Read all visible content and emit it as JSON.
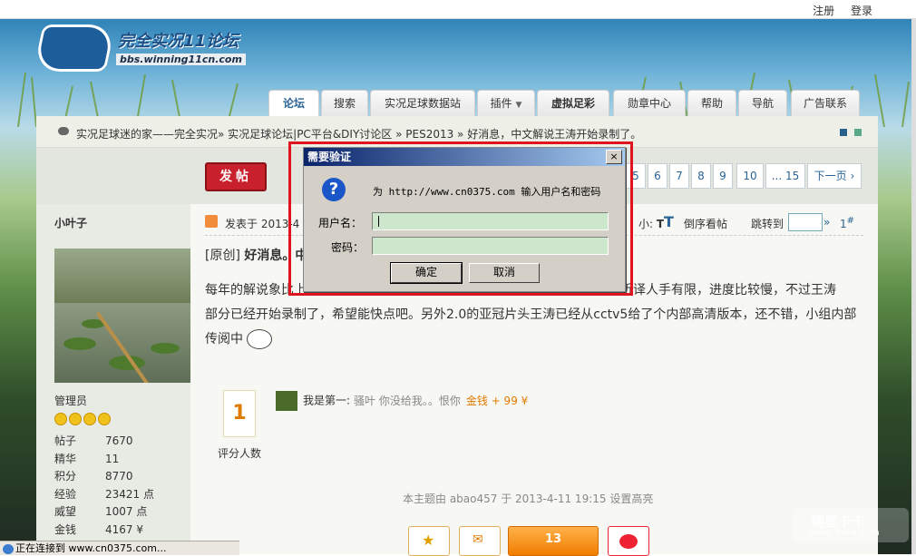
{
  "topbar": {
    "register": "注册",
    "login": "登录"
  },
  "logo": {
    "title": "完全实况11论坛",
    "url": "bbs.winning11cn.com"
  },
  "nav": {
    "tabs": [
      "论坛",
      "搜索",
      "实况足球数据站",
      "插件",
      "虚拟足彩",
      "勋章中心",
      "帮助",
      "导航",
      "广告联系"
    ]
  },
  "breadcrumb": "实况足球迷的家——完全实况» 实况足球论坛|PC平台&DIY讨论区 » PES2013 » 好消息，中文解说王涛开始录制了。",
  "toolbar": {
    "post_label": "发帖",
    "pages": [
      "5",
      "6",
      "7",
      "8",
      "9",
      "10",
      "... 15"
    ],
    "next_label": "下一页"
  },
  "author": {
    "name": "小叶子",
    "role": "管理员",
    "stats": [
      {
        "k": "帖子",
        "v": "7670"
      },
      {
        "k": "精华",
        "v": "11"
      },
      {
        "k": "积分",
        "v": "8770"
      },
      {
        "k": "经验",
        "v": "23421 点"
      },
      {
        "k": "威望",
        "v": "1007 点"
      },
      {
        "k": "金钱",
        "v": "4167 ¥"
      }
    ]
  },
  "post": {
    "posted_prefix": "发表于 2013-4",
    "font_small": "小:",
    "font_t": "T",
    "font_big": "T",
    "reverse": "倒序看帖",
    "jump": "跳转到",
    "jump_arrow": "»",
    "floor": "1",
    "floor_mark": "#",
    "title_prefix": "[原创]",
    "title": "好消息。中",
    "body_line1": "每年的解说象比上",
    "body_line1_end": "前听译人手有限，进度比较慢，不过王涛",
    "body_line2": "部分已经开始录制了，希望能快点吧。另外2.0的亚冠片头王涛已经从cctv5给了个内部高清版本，还不错，小组内部",
    "body_line3": "传阅中",
    "rate_count": "1",
    "rate_label": "评分人数",
    "rater_text": "我是第一:",
    "rater_comment": "骚叶 你没给我。。恨你",
    "rater_gold": "金钱 + 99 ¥",
    "moderation": "本主题由 abao457 于 2013-4-11 19:15 设置高亮",
    "action_count": "13"
  },
  "dialog": {
    "title": "需要验证",
    "close": "×",
    "icon": "?",
    "message": "为 http://www.cn0375.com 输入用户名和密码",
    "user_label": "用户名：",
    "pass_label": "密码：",
    "ok": "确定",
    "cancel": "取消"
  },
  "status": "正在连接到 www.cn0375.com...",
  "watermark": {
    "brand": "瑞星卡卡",
    "url": "www.ikaka.com"
  }
}
